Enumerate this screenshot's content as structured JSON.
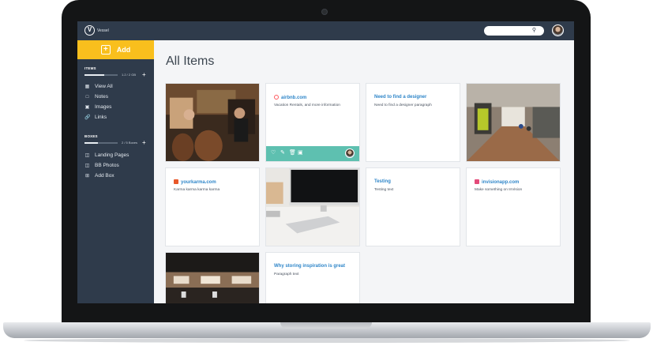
{
  "app": {
    "name": "Vessel"
  },
  "header": {
    "search_placeholder": ""
  },
  "sidebar": {
    "add_label": "Add",
    "items_section": {
      "heading": "ITEMS",
      "usage": "1.2 / 2 GB",
      "usage_fraction": 0.6,
      "entries": [
        {
          "label": "View All",
          "icon": "grid-icon"
        },
        {
          "label": "Notes",
          "icon": "note-icon"
        },
        {
          "label": "Images",
          "icon": "image-icon"
        },
        {
          "label": "Links",
          "icon": "link-icon"
        }
      ]
    },
    "boxes_section": {
      "heading": "BOXES",
      "usage": "2 / 5 Boxes",
      "usage_fraction": 0.4,
      "entries": [
        {
          "label": "Landing Pages",
          "icon": "box-icon"
        },
        {
          "label": "BB Photos",
          "icon": "box-icon"
        },
        {
          "label": "Add Box",
          "icon": "add-box-icon"
        }
      ]
    }
  },
  "main": {
    "title": "All Items",
    "cards": [
      {
        "type": "image",
        "name": "bar-photo"
      },
      {
        "type": "link",
        "title": "airbnb.com",
        "subtitle": "Vacation Rentals, and more information",
        "favicon_color": "#ff5a5f"
      },
      {
        "type": "note",
        "title": "Need to find a designer",
        "subtitle": "Need to find a designer paragraph"
      },
      {
        "type": "image",
        "name": "hallway-photo"
      },
      {
        "type": "link",
        "title": "yourkarma.com",
        "subtitle": "Karma karma karma karma",
        "favicon_color": "#e8582a"
      },
      {
        "type": "image",
        "name": "desk-photo"
      },
      {
        "type": "note",
        "title": "Testing",
        "subtitle": "Testing text"
      },
      {
        "type": "link",
        "title": "invisionapp.com",
        "subtitle": "Make something on InVision",
        "favicon_color": "#e34a7a"
      },
      {
        "type": "image",
        "name": "office-photo"
      },
      {
        "type": "note",
        "title": "Why storing inspiration is great",
        "subtitle": "Paragraph text"
      }
    ]
  },
  "colors": {
    "sidebar": "#2f3b4b",
    "accent": "#f9bf1d",
    "link": "#2f86c9",
    "action_bar": "#5ec0b0"
  }
}
